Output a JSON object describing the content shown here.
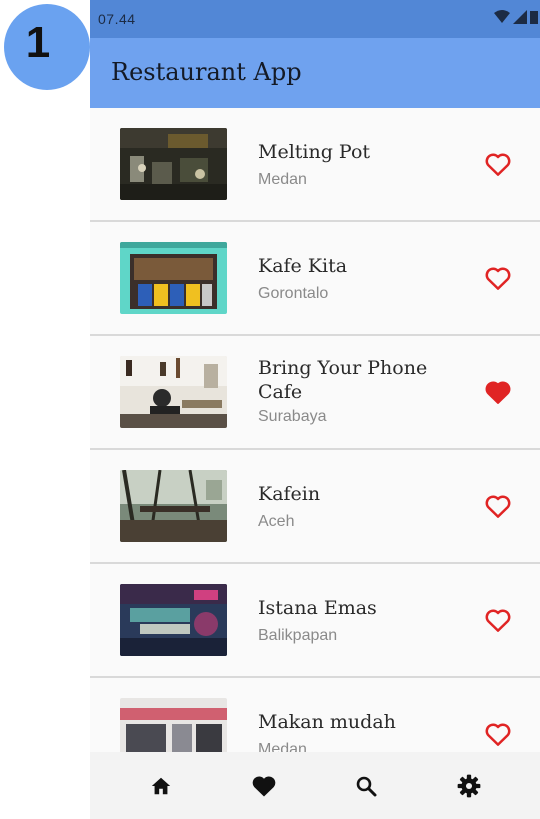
{
  "step_badge": "1",
  "status_bar": {
    "time": "07.44"
  },
  "app_bar": {
    "title": "Restaurant App"
  },
  "restaurants": [
    {
      "name": "Melting Pot",
      "city": "Medan",
      "favorite": false
    },
    {
      "name": "Kafe Kita",
      "city": "Gorontalo",
      "favorite": false
    },
    {
      "name": "Bring Your Phone Cafe",
      "city": "Surabaya",
      "favorite": true
    },
    {
      "name": "Kafein",
      "city": "Aceh",
      "favorite": false
    },
    {
      "name": "Istana Emas",
      "city": "Balikpapan",
      "favorite": false
    },
    {
      "name": "Makan mudah",
      "city": "Medan",
      "favorite": false
    }
  ],
  "bottom_nav": [
    {
      "icon": "home-icon"
    },
    {
      "icon": "heart-icon"
    },
    {
      "icon": "search-icon"
    },
    {
      "icon": "gear-icon"
    }
  ],
  "colors": {
    "app_bar": "#6fa2ef",
    "status_bar": "#5287d6",
    "favorite": "#e02424",
    "badge": "#6aa2f0"
  }
}
